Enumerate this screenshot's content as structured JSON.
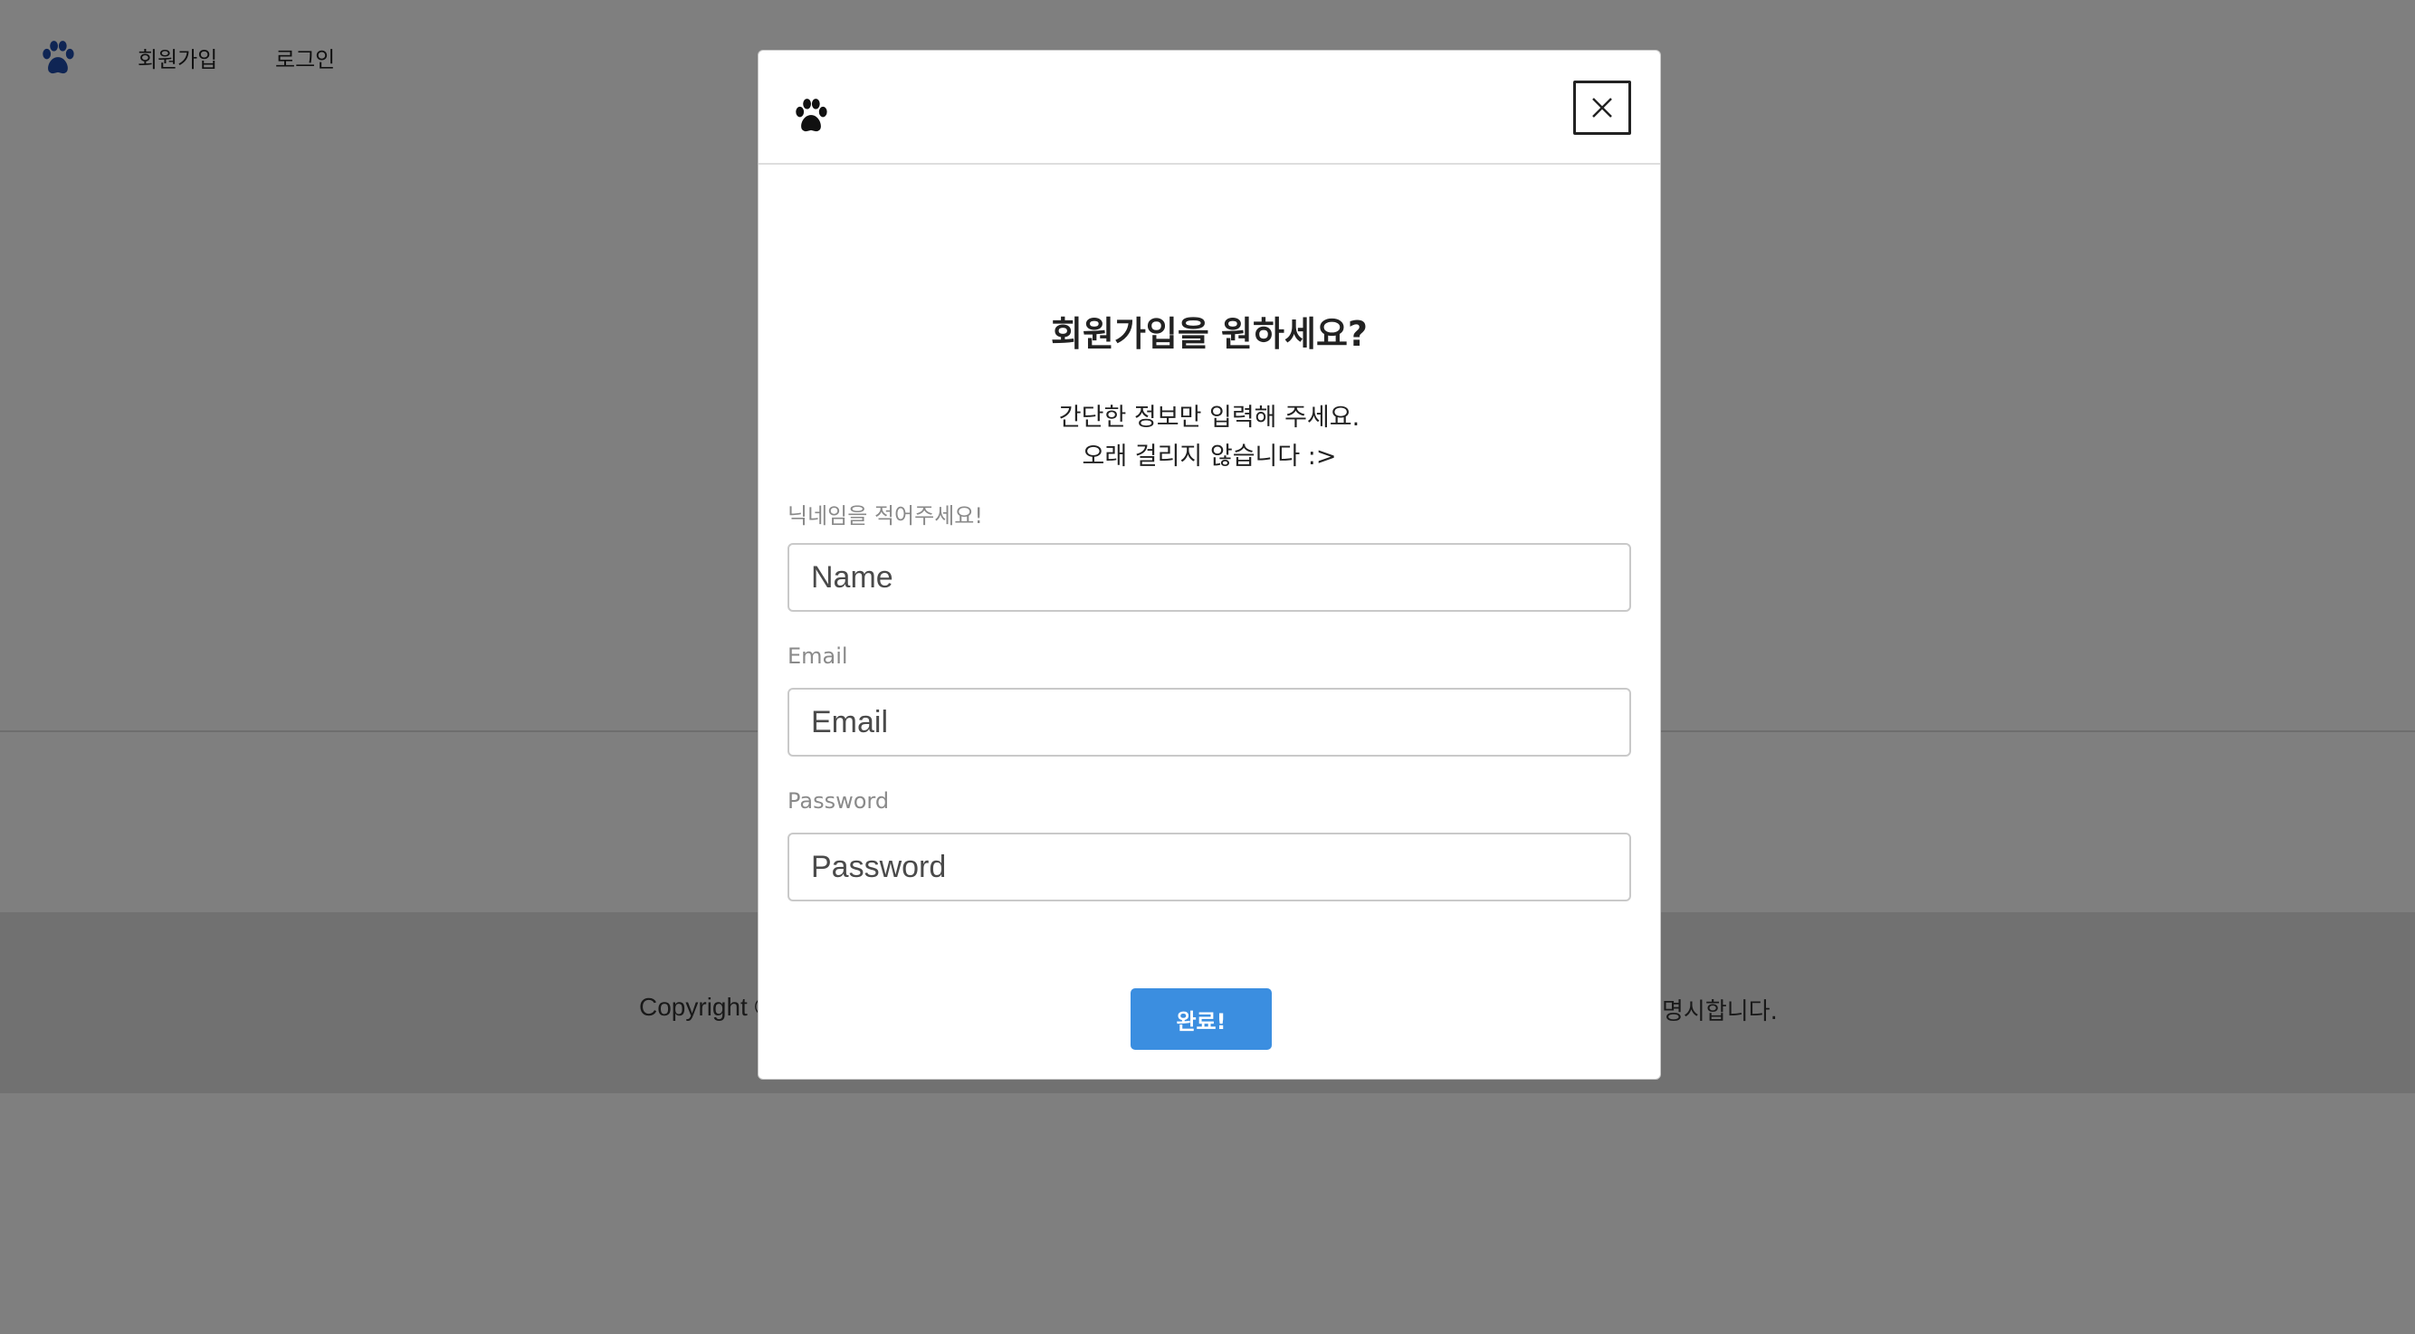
{
  "nav": {
    "logo_icon": "paw-icon",
    "signup_label": "회원가입",
    "login_label": "로그인"
  },
  "footer": {
    "left_text": "Copyright ©",
    "right_text": "명시합니다."
  },
  "modal": {
    "logo_icon": "paw-icon",
    "close_icon": "close-icon",
    "title": "회원가입을 원하세요?",
    "subtitle_line1": "간단한 정보만 입력해 주세요.",
    "subtitle_line2": "오래 걸리지 않습니다 :>",
    "fields": [
      {
        "label": "닉네임을 적어주세요!",
        "placeholder": "Name",
        "value": ""
      },
      {
        "label": "Email",
        "placeholder": "Email",
        "value": ""
      },
      {
        "label": "Password",
        "placeholder": "Password",
        "value": ""
      }
    ],
    "submit_label": "완료!"
  },
  "colors": {
    "accent": "#3b8ee0",
    "nav_logo": "#1f4aa8",
    "overlay": "rgba(0,0,0,0.5)"
  }
}
